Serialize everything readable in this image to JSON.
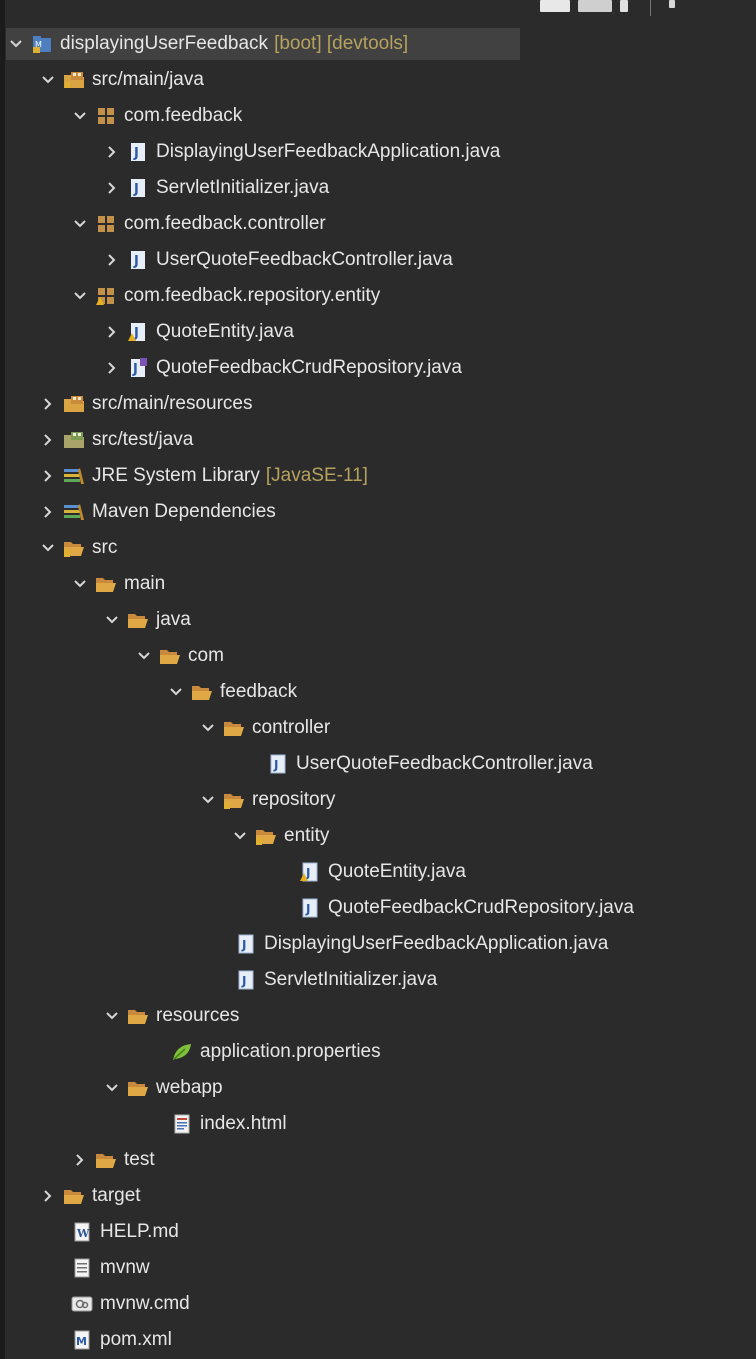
{
  "tree": {
    "rows": [
      {
        "label": "displayingUserFeedback",
        "deco": "[boot] [devtools]"
      },
      {
        "label": "src/main/java"
      },
      {
        "label": "com.feedback"
      },
      {
        "label": "DisplayingUserFeedbackApplication.java"
      },
      {
        "label": "ServletInitializer.java"
      },
      {
        "label": "com.feedback.controller"
      },
      {
        "label": "UserQuoteFeedbackController.java"
      },
      {
        "label": "com.feedback.repository.entity"
      },
      {
        "label": "QuoteEntity.java"
      },
      {
        "label": "QuoteFeedbackCrudRepository.java"
      },
      {
        "label": "src/main/resources"
      },
      {
        "label": "src/test/java"
      },
      {
        "label": "JRE System Library",
        "deco": "[JavaSE-11]"
      },
      {
        "label": "Maven Dependencies"
      },
      {
        "label": "src"
      },
      {
        "label": "main"
      },
      {
        "label": "java"
      },
      {
        "label": "com"
      },
      {
        "label": "feedback"
      },
      {
        "label": "controller"
      },
      {
        "label": "UserQuoteFeedbackController.java"
      },
      {
        "label": "repository"
      },
      {
        "label": "entity"
      },
      {
        "label": "QuoteEntity.java"
      },
      {
        "label": "QuoteFeedbackCrudRepository.java"
      },
      {
        "label": "DisplayingUserFeedbackApplication.java"
      },
      {
        "label": "ServletInitializer.java"
      },
      {
        "label": "resources"
      },
      {
        "label": "application.properties"
      },
      {
        "label": "webapp"
      },
      {
        "label": "index.html"
      },
      {
        "label": "test"
      },
      {
        "label": "target"
      },
      {
        "label": "HELP.md"
      },
      {
        "label": "mvnw"
      },
      {
        "label": "mvnw.cmd"
      },
      {
        "label": "pom.xml"
      }
    ]
  },
  "colors": {
    "background": "#2b2b2b",
    "text": "#e6e6e6",
    "decoration": "#b5a25e",
    "selection": "#414141"
  }
}
